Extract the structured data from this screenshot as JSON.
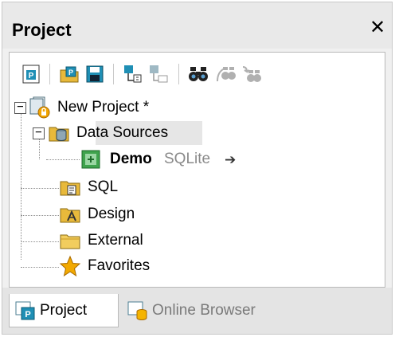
{
  "panel": {
    "title": "Project",
    "close_glyph": "✕"
  },
  "toolbar": {
    "buttons": [
      {
        "icon": "new-project-icon"
      },
      {
        "icon": "open-project-icon"
      },
      {
        "icon": "save-project-icon"
      },
      {
        "icon": "add-files-icon"
      },
      {
        "icon": "add-folder-icon"
      },
      {
        "icon": "find-icon"
      },
      {
        "icon": "find-next-icon"
      },
      {
        "icon": "replace-icon"
      }
    ]
  },
  "tree": {
    "root": {
      "label": "New Project *",
      "expander": "−",
      "icon": "project-icon"
    },
    "data_sources": {
      "label": "Data Sources",
      "expander": "−",
      "icon": "data-folder-icon"
    },
    "demo": {
      "label": "Demo",
      "sublabel": "SQLite",
      "arrow": "➔",
      "icon": "database-connection-icon"
    },
    "sql": {
      "label": "SQL",
      "icon": "sql-folder-icon"
    },
    "design": {
      "label": "Design",
      "icon": "design-folder-icon"
    },
    "external": {
      "label": "External",
      "icon": "folder-icon"
    },
    "favorites": {
      "label": "Favorites",
      "icon": "star-icon"
    }
  },
  "tabs": [
    {
      "label": "Project",
      "active": true,
      "icon": "project-tab-icon"
    },
    {
      "label": "Online Browser",
      "active": false,
      "icon": "online-browser-icon"
    }
  ],
  "colors": {
    "title_bg": "#e9e9e9",
    "selection": "#e6e6e6",
    "project_blue": "#1f8fb5",
    "folder_yellow": "#e8b93b",
    "star": "#f2a900"
  }
}
